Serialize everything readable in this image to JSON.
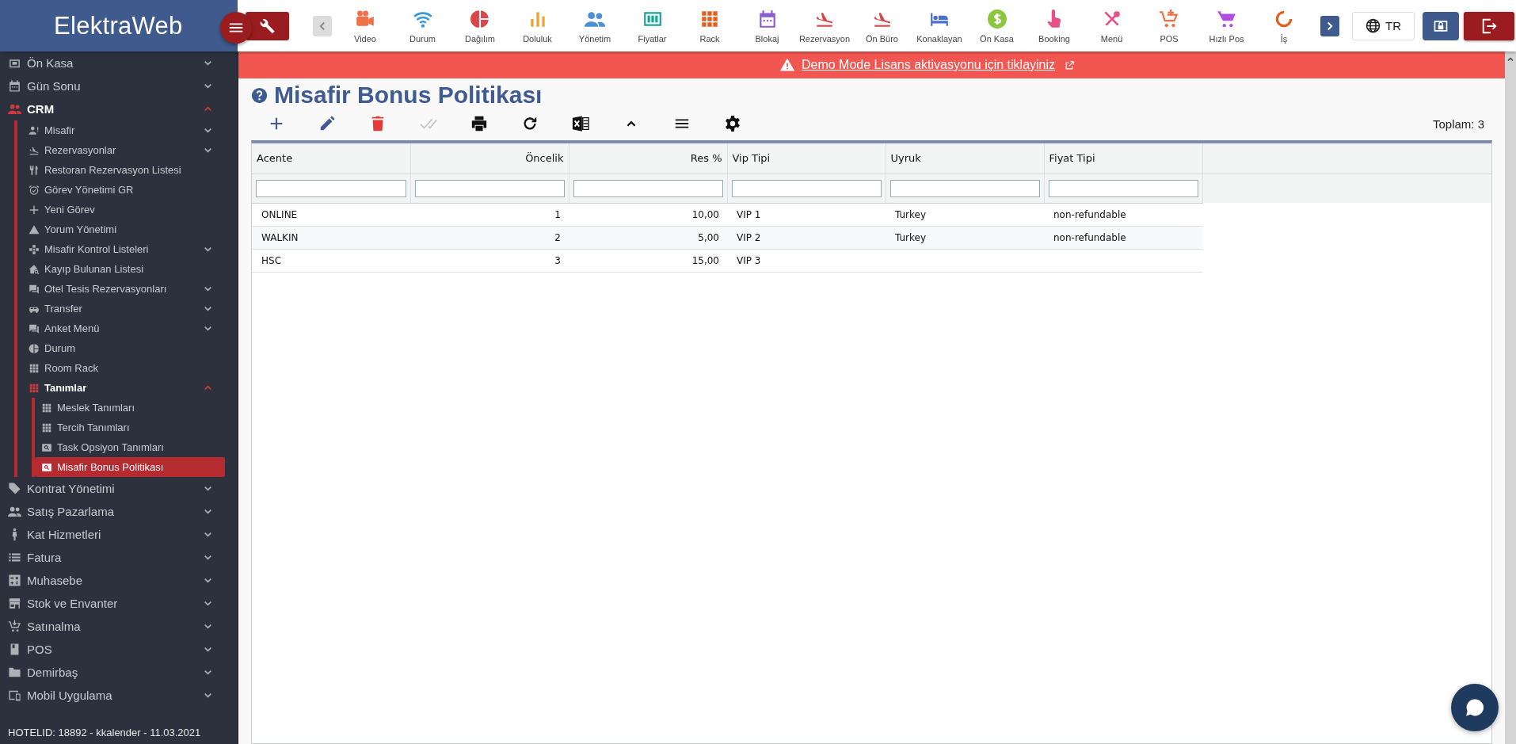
{
  "header": {
    "logo": "ElektraWeb",
    "modules": [
      {
        "label": "Video",
        "color": "#f07048"
      },
      {
        "label": "Durum",
        "color": "#3a9ad9"
      },
      {
        "label": "Dağılım",
        "color": "#d9474b"
      },
      {
        "label": "Doluluk",
        "color": "#f0a030"
      },
      {
        "label": "Yönetim",
        "color": "#4a90d9"
      },
      {
        "label": "Fiyatlar",
        "color": "#1aa59a"
      },
      {
        "label": "Rack",
        "color": "#e06020"
      },
      {
        "label": "Blokaj",
        "color": "#8a5cd0"
      },
      {
        "label": "Rezervasyon",
        "color": "#d9474b"
      },
      {
        "label": "Ön Büro",
        "color": "#d9474b"
      },
      {
        "label": "Konaklayan",
        "color": "#4a6fd0"
      },
      {
        "label": "Ön Kasa",
        "color": "#8cc63f"
      },
      {
        "label": "Booking",
        "color": "#e8508a"
      },
      {
        "label": "Menü",
        "color": "#e8508a"
      },
      {
        "label": "POS",
        "color": "#f07048"
      },
      {
        "label": "Hızlı Pos",
        "color": "#b050e0"
      },
      {
        "label": "İş",
        "color": "#e06020"
      }
    ],
    "language": "TR"
  },
  "sidebar": {
    "items": [
      {
        "label": "Ön Kasa",
        "kind": "group",
        "expanded": false,
        "selected": false
      },
      {
        "label": "Gün Sonu",
        "kind": "group",
        "expanded": false,
        "selected": false
      },
      {
        "label": "CRM",
        "kind": "group",
        "expanded": true,
        "selected": false,
        "children": [
          {
            "label": "Misafir",
            "kind": "group",
            "expanded": false,
            "selected": false
          },
          {
            "label": "Rezervasyonlar",
            "kind": "group",
            "expanded": false,
            "selected": false
          },
          {
            "label": "Restoran Rezervasyon Listesi",
            "kind": "link",
            "expanded": false,
            "selected": false
          },
          {
            "label": "Görev Yönetimi GR",
            "kind": "link",
            "expanded": false,
            "selected": false
          },
          {
            "label": "Yeni Görev",
            "kind": "link",
            "expanded": false,
            "selected": false
          },
          {
            "label": "Yorum Yönetimi",
            "kind": "link",
            "expanded": false,
            "selected": false
          },
          {
            "label": "Misafir Kontrol Listeleri",
            "kind": "group",
            "expanded": false,
            "selected": false
          },
          {
            "label": "Kayıp Bulunan Listesi",
            "kind": "link",
            "expanded": false,
            "selected": false
          },
          {
            "label": "Otel Tesis Rezervasyonları",
            "kind": "group",
            "expanded": false,
            "selected": false
          },
          {
            "label": "Transfer",
            "kind": "group",
            "expanded": false,
            "selected": false
          },
          {
            "label": "Anket Menü",
            "kind": "group",
            "expanded": false,
            "selected": false
          },
          {
            "label": "Durum",
            "kind": "link",
            "expanded": false,
            "selected": false
          },
          {
            "label": "Room Rack",
            "kind": "link",
            "expanded": false,
            "selected": false
          },
          {
            "label": "Tanımlar",
            "kind": "group",
            "expanded": true,
            "selected": false,
            "children": [
              {
                "label": "Meslek Tanımları",
                "kind": "link",
                "expanded": false,
                "selected": false
              },
              {
                "label": "Tercih Tanımları",
                "kind": "link",
                "expanded": false,
                "selected": false
              },
              {
                "label": "Task Opsiyon Tanımları",
                "kind": "link",
                "expanded": false,
                "selected": false
              },
              {
                "label": "Misafir Bonus Politikası",
                "kind": "link",
                "expanded": false,
                "selected": true
              }
            ]
          }
        ]
      },
      {
        "label": "Kontrat Yönetimi",
        "kind": "group",
        "expanded": false,
        "selected": false
      },
      {
        "label": "Satış Pazarlama",
        "kind": "group",
        "expanded": false,
        "selected": false
      },
      {
        "label": "Kat Hizmetleri",
        "kind": "group",
        "expanded": false,
        "selected": false
      },
      {
        "label": "Fatura",
        "kind": "group",
        "expanded": false,
        "selected": false
      },
      {
        "label": "Muhasebe",
        "kind": "group",
        "expanded": false,
        "selected": false
      },
      {
        "label": "Stok ve Envanter",
        "kind": "group",
        "expanded": false,
        "selected": false
      },
      {
        "label": "Satınalma",
        "kind": "group",
        "expanded": false,
        "selected": false
      },
      {
        "label": "POS",
        "kind": "group",
        "expanded": false,
        "selected": false
      },
      {
        "label": "Demirbaş",
        "kind": "group",
        "expanded": false,
        "selected": false
      },
      {
        "label": "Mobil Uygulama",
        "kind": "group",
        "expanded": false,
        "selected": false
      }
    ],
    "status": "HOTELID: 18892 - kkalender - 11.03.2021"
  },
  "banner": {
    "text": "Demo Mode Lisans aktivasyonu için tiklayiniz"
  },
  "page": {
    "title": "Misafir Bonus Politikası",
    "tools": [
      {
        "disabled": false
      },
      {
        "disabled": false
      },
      {
        "disabled": false
      },
      {
        "disabled": true
      },
      {
        "disabled": false
      },
      {
        "disabled": false
      },
      {
        "disabled": false
      },
      {
        "disabled": false
      },
      {
        "disabled": false
      },
      {
        "disabled": false
      }
    ],
    "total": "Toplam: 3"
  },
  "table": {
    "columns": [
      "Acente",
      "Öncelik",
      "Res %",
      "Vip Tipi",
      "Uyruk",
      "Fiyat Tipi"
    ],
    "rows": [
      {
        "acente": "ONLINE",
        "oncelik": "1",
        "res": "10,00",
        "vip_tipi": "VIP 1",
        "uyruk": "Turkey",
        "fiyat_tipi": "non-refundable"
      },
      {
        "acente": "WALKIN",
        "oncelik": "2",
        "res": "5,00",
        "vip_tipi": "VIP 2",
        "uyruk": "Turkey",
        "fiyat_tipi": "non-refundable"
      },
      {
        "acente": "HSC",
        "oncelik": "3",
        "res": "15,00",
        "vip_tipi": "VIP 3"
      }
    ]
  }
}
